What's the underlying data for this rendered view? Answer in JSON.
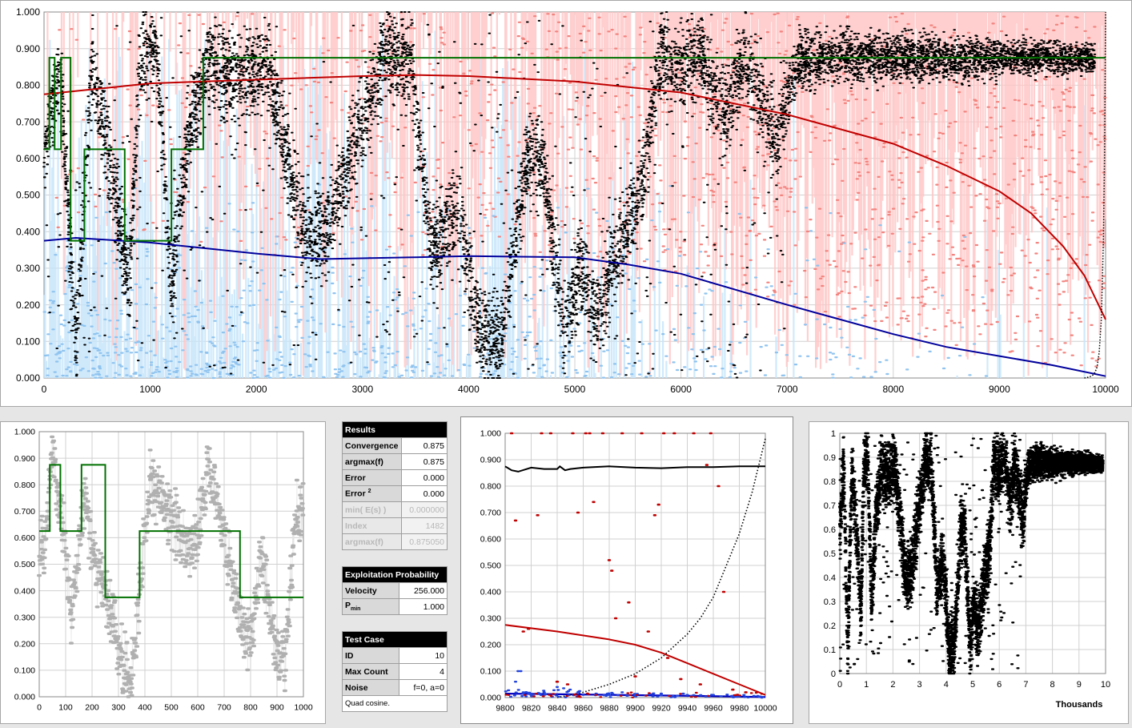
{
  "chart_data": [
    {
      "id": "main",
      "type": "scatter",
      "title": "",
      "xlim": [
        0,
        10000
      ],
      "ylim": [
        0,
        1
      ],
      "x_ticks": [
        "0",
        "1000",
        "2000",
        "3000",
        "4000",
        "5000",
        "6000",
        "7000",
        "8000",
        "9000",
        "10000"
      ],
      "y_ticks": [
        "0.000",
        "0.100",
        "0.200",
        "0.300",
        "0.400",
        "0.500",
        "0.600",
        "0.700",
        "0.800",
        "0.900",
        "1.000"
      ],
      "grid": true,
      "series": [
        {
          "role": "upper-curve",
          "color": "#c00000",
          "x": [
            0,
            1000,
            2000,
            3000,
            3500,
            4000,
            5000,
            6000,
            7000,
            8000,
            8500,
            9000,
            9300,
            9600,
            9800,
            10000
          ],
          "y": [
            0.775,
            0.805,
            0.815,
            0.825,
            0.828,
            0.825,
            0.81,
            0.78,
            0.72,
            0.64,
            0.58,
            0.51,
            0.45,
            0.36,
            0.28,
            0.16
          ]
        },
        {
          "role": "lower-curve",
          "color": "#00009c",
          "x": [
            0,
            300,
            1000,
            2000,
            2600,
            3500,
            4000,
            5000,
            5500,
            6000,
            7000,
            7500,
            8000,
            8500,
            9000,
            9500,
            10000
          ],
          "y": [
            0.375,
            0.383,
            0.37,
            0.34,
            0.325,
            0.33,
            0.333,
            0.33,
            0.31,
            0.285,
            0.2,
            0.16,
            0.12,
            0.085,
            0.06,
            0.035,
            0.005
          ]
        },
        {
          "role": "target-step",
          "color": "#007000",
          "steps": [
            [
              0,
              0.625
            ],
            [
              50,
              0.875
            ],
            [
              100,
              0.625
            ],
            [
              160,
              0.875
            ],
            [
              250,
              0.375
            ],
            [
              380,
              0.625
            ],
            [
              760,
              0.375
            ],
            [
              1200,
              0.625
            ],
            [
              1500,
              0.875
            ],
            [
              10000,
              0.875
            ]
          ]
        },
        {
          "role": "exploit-probability",
          "color": "#000000",
          "style": "dotted",
          "x": [
            9800,
            9850,
            9880,
            9900,
            9920,
            9940,
            9960,
            9980,
            9990,
            10000
          ],
          "y": [
            0,
            0.003,
            0.008,
            0.015,
            0.03,
            0.07,
            0.16,
            0.38,
            0.6,
            1.0
          ]
        }
      ],
      "sample_segments": [
        [
          0,
          0.62
        ],
        [
          150,
          0.85
        ],
        [
          300,
          0.08
        ],
        [
          450,
          0.85
        ],
        [
          650,
          0.55
        ],
        [
          800,
          0.25
        ],
        [
          900,
          0.85
        ],
        [
          1050,
          0.92
        ],
        [
          1200,
          0.25
        ],
        [
          1350,
          0.65
        ],
        [
          1550,
          0.85
        ],
        [
          1800,
          0.82
        ],
        [
          2100,
          0.85
        ],
        [
          2450,
          0.4
        ],
        [
          2650,
          0.4
        ],
        [
          2900,
          0.62
        ],
        [
          3200,
          0.87
        ],
        [
          3450,
          0.88
        ],
        [
          3650,
          0.35
        ],
        [
          3900,
          0.48
        ],
        [
          4100,
          0.12
        ],
        [
          4300,
          0.1
        ],
        [
          4550,
          0.6
        ],
        [
          4700,
          0.6
        ],
        [
          4900,
          0.12
        ],
        [
          5050,
          0.3
        ],
        [
          5200,
          0.15
        ],
        [
          5400,
          0.35
        ],
        [
          5650,
          0.55
        ],
        [
          5800,
          0.88
        ],
        [
          6000,
          0.85
        ],
        [
          6200,
          0.88
        ],
        [
          6400,
          0.72
        ],
        [
          6600,
          0.88
        ],
        [
          6900,
          0.65
        ],
        [
          7100,
          0.87
        ],
        [
          7500,
          0.88
        ],
        [
          8000,
          0.875
        ],
        [
          8500,
          0.875
        ],
        [
          9000,
          0.875
        ],
        [
          9500,
          0.875
        ],
        [
          9850,
          0.875
        ]
      ]
    },
    {
      "id": "detail",
      "type": "scatter",
      "xlim": [
        0,
        1000
      ],
      "ylim": [
        0,
        1
      ],
      "x_ticks": [
        "0",
        "100",
        "200",
        "300",
        "400",
        "500",
        "600",
        "700",
        "800",
        "900",
        "1000"
      ],
      "y_ticks": [
        "0.000",
        "0.100",
        "0.200",
        "0.300",
        "0.400",
        "0.500",
        "0.600",
        "0.700",
        "0.800",
        "0.900",
        "1.000"
      ],
      "grid": true,
      "series": [
        {
          "role": "target-step",
          "color": "#007000",
          "steps": [
            [
              0,
              0.625
            ],
            [
              40,
              0.875
            ],
            [
              80,
              0.625
            ],
            [
              160,
              0.875
            ],
            [
              250,
              0.375
            ],
            [
              380,
              0.625
            ],
            [
              760,
              0.375
            ],
            [
              1000,
              0.375
            ]
          ]
        }
      ],
      "point_clusters": [
        [
          20,
          0.55
        ],
        [
          50,
          0.92
        ],
        [
          90,
          0.65
        ],
        [
          120,
          0.3
        ],
        [
          170,
          0.75
        ],
        [
          210,
          0.5
        ],
        [
          250,
          0.4
        ],
        [
          320,
          0.12
        ],
        [
          350,
          0.08
        ],
        [
          420,
          0.82
        ],
        [
          470,
          0.72
        ],
        [
          520,
          0.65
        ],
        [
          580,
          0.55
        ],
        [
          640,
          0.85
        ],
        [
          700,
          0.6
        ],
        [
          760,
          0.3
        ],
        [
          800,
          0.2
        ],
        [
          840,
          0.55
        ],
        [
          890,
          0.2
        ],
        [
          930,
          0.12
        ],
        [
          970,
          0.7
        ]
      ]
    },
    {
      "id": "zoom",
      "type": "scatter",
      "xlim": [
        9800,
        10000
      ],
      "ylim": [
        0,
        1
      ],
      "x_ticks": [
        "9800",
        "9820",
        "9840",
        "9860",
        "9880",
        "9900",
        "9920",
        "9940",
        "9960",
        "9980",
        "10000"
      ],
      "y_ticks": [
        "0.000",
        "0.100",
        "0.200",
        "0.300",
        "0.400",
        "0.500",
        "0.600",
        "0.700",
        "0.800",
        "0.900",
        "1.000"
      ],
      "grid": true,
      "series": [
        {
          "role": "estimate",
          "color": "#000000",
          "x": [
            9800,
            9805,
            9810,
            9820,
            9830,
            9840,
            9842,
            9846,
            9850,
            9860,
            9880,
            9900,
            9920,
            9940,
            9960,
            9980,
            10000
          ],
          "y": [
            0.875,
            0.86,
            0.855,
            0.87,
            0.865,
            0.865,
            0.875,
            0.86,
            0.865,
            0.87,
            0.875,
            0.87,
            0.868,
            0.872,
            0.872,
            0.875,
            0.875
          ]
        },
        {
          "role": "upper-curve",
          "color": "#c00000",
          "x": [
            9800,
            9840,
            9880,
            9900,
            9920,
            9940,
            9960,
            9980,
            10000
          ],
          "y": [
            0.275,
            0.25,
            0.22,
            0.2,
            0.17,
            0.13,
            0.09,
            0.05,
            0.01
          ]
        },
        {
          "role": "lower-curve",
          "color": "#0000c0",
          "x": [
            9800,
            9850,
            9900,
            9950,
            10000
          ],
          "y": [
            0.015,
            0.012,
            0.009,
            0.006,
            0.002
          ]
        },
        {
          "role": "exploit-probability",
          "color": "#000000",
          "style": "dotted",
          "x": [
            9840,
            9860,
            9880,
            9900,
            9920,
            9940,
            9950,
            9960,
            9970,
            9980,
            9990,
            10000
          ],
          "y": [
            0,
            0.02,
            0.05,
            0.09,
            0.15,
            0.24,
            0.3,
            0.38,
            0.5,
            0.62,
            0.78,
            0.98
          ]
        }
      ],
      "red_points": [
        [
          9805,
          1.0
        ],
        [
          9808,
          0.67
        ],
        [
          9814,
          0.25
        ],
        [
          9818,
          0.26
        ],
        [
          9825,
          0.69
        ],
        [
          9828,
          1.0
        ],
        [
          9835,
          1.0
        ],
        [
          9840,
          0.06
        ],
        [
          9848,
          0.05
        ],
        [
          9852,
          1.0
        ],
        [
          9856,
          0.7
        ],
        [
          9862,
          1.0
        ],
        [
          9865,
          1.0
        ],
        [
          9868,
          0.74
        ],
        [
          9875,
          1.0
        ],
        [
          9880,
          0.52
        ],
        [
          9882,
          0.48
        ],
        [
          9885,
          0.3
        ],
        [
          9890,
          1.0
        ],
        [
          9895,
          0.36
        ],
        [
          9900,
          0.08
        ],
        [
          9905,
          1.0
        ],
        [
          9910,
          0.25
        ],
        [
          9915,
          0.69
        ],
        [
          9918,
          0.73
        ],
        [
          9922,
          1.0
        ],
        [
          9925,
          0.15
        ],
        [
          9930,
          1.0
        ],
        [
          9935,
          0.07
        ],
        [
          9945,
          1.0
        ],
        [
          9950,
          0.05
        ],
        [
          9955,
          0.88
        ],
        [
          9958,
          1.0
        ],
        [
          9964,
          0.8
        ],
        [
          9968,
          0.4
        ],
        [
          9975,
          0.03
        ],
        [
          9985,
          0.02
        ]
      ],
      "blue_points": [
        [
          9808,
          0.06
        ],
        [
          9810,
          0.1
        ],
        [
          9812,
          0.1
        ],
        [
          9814,
          0.02
        ],
        [
          9820,
          0.01
        ],
        [
          9830,
          0.02
        ],
        [
          9840,
          0.04
        ],
        [
          9845,
          0.035
        ],
        [
          9850,
          0.03
        ],
        [
          9860,
          0.01
        ],
        [
          9870,
          0.015
        ],
        [
          9880,
          0.01
        ],
        [
          9890,
          0.02
        ],
        [
          9900,
          0.008
        ],
        [
          9920,
          0.015
        ],
        [
          9940,
          0.01
        ],
        [
          9960,
          0.01
        ],
        [
          9980,
          0.005
        ]
      ]
    },
    {
      "id": "overview",
      "type": "scatter",
      "xlim": [
        0,
        10
      ],
      "ylim": [
        0,
        1
      ],
      "xlabel": "Thousands",
      "x_ticks": [
        "0",
        "1",
        "2",
        "3",
        "4",
        "5",
        "6",
        "7",
        "8",
        "9",
        "10"
      ],
      "y_ticks": [
        "0",
        "0.1",
        "0.2",
        "0.3",
        "0.4",
        "0.5",
        "0.6",
        "0.7",
        "0.8",
        "0.9",
        "1"
      ],
      "grid": true
    }
  ],
  "results": {
    "header": "Results",
    "rows": [
      {
        "label": "Convergence",
        "value": "0.875"
      },
      {
        "label": "argmax(f)",
        "value": "0.875"
      },
      {
        "label": "Error",
        "value": "0.000"
      },
      {
        "label": "Error",
        "sup": "2",
        "value": "0.000"
      }
    ],
    "dim_rows": [
      {
        "label": "min( E(s) )",
        "value": "0.000000"
      },
      {
        "label": "Index",
        "value": "1482"
      },
      {
        "label": "argmax(f)",
        "value": "0.875050"
      }
    ]
  },
  "exploitation": {
    "header": "Exploitation Probability",
    "velocity_label": "Velocity",
    "velocity_value": "256.000",
    "pmin_label": "P",
    "pmin_sub": "min",
    "pmin_value": "1.000"
  },
  "test_case": {
    "header": "Test Case",
    "rows": [
      {
        "label": "ID",
        "value": "10"
      },
      {
        "label": "Max Count",
        "value": "4"
      },
      {
        "label": "Noise",
        "value": "f=0, a=0"
      }
    ],
    "note": "Quad cosine."
  },
  "colors": {
    "red_band": "#ffc7c7",
    "blue_band": "#c7e6fb",
    "green": "#007000",
    "red": "#c00000",
    "blue": "#00009c",
    "grid": "#d0d0d0"
  }
}
